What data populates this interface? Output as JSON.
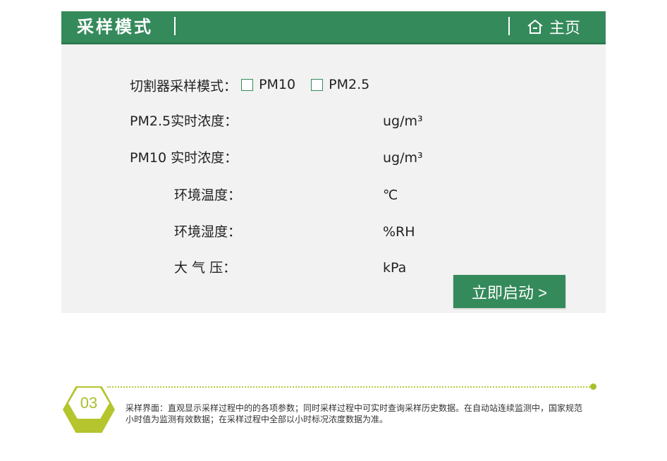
{
  "header": {
    "title": "采样模式",
    "home_label": "主页"
  },
  "cutter": {
    "label": "切割器采样模式：",
    "options": [
      "PM10",
      "PM2.5"
    ]
  },
  "rows": [
    {
      "label": "PM2.5实时浓度：",
      "unit": "ug/m³"
    },
    {
      "label": "PM10 实时浓度：",
      "unit": "ug/m³"
    },
    {
      "label": "环境温度：",
      "unit": "℃"
    },
    {
      "label": "环境湿度：",
      "unit": "%RH"
    },
    {
      "label": "大 气 压：",
      "unit": "kPa"
    }
  ],
  "start_button": "立即启动 >",
  "footer": {
    "number": "03",
    "description": "采样界面：直观显示采样过程中的的各项参数；同时采样过程中可实时查询采样历史数据。在自动站连续监测中，国家规范小时值为监测有效数据；在采样过程中全部以小时标况浓度数据为准。"
  },
  "colors": {
    "brand_green": "#358a5b",
    "accent_lime": "#b4c52e"
  },
  "icons": {
    "home": "home-icon"
  }
}
